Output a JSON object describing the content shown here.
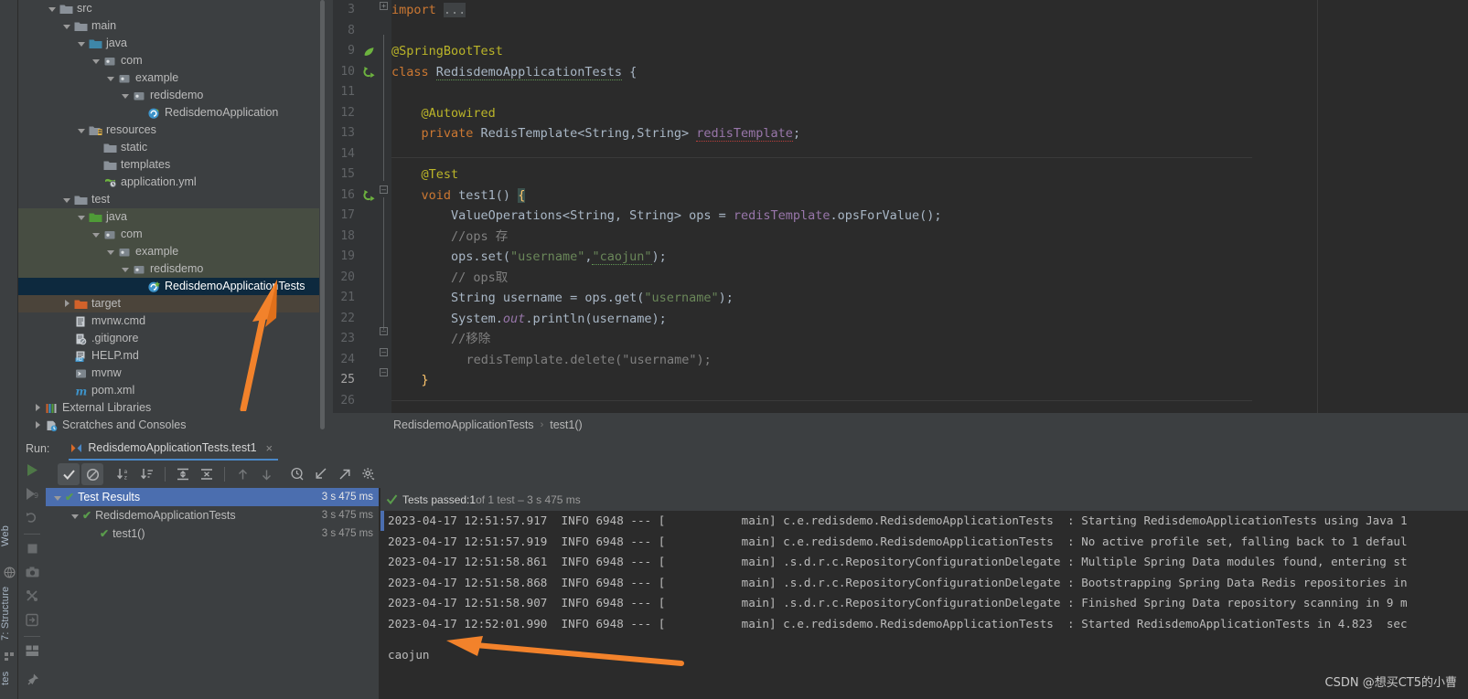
{
  "left_strip": {
    "labels": [
      {
        "name": "web",
        "text": "Web"
      },
      {
        "name": "structure",
        "text": "7: Structure"
      },
      {
        "name": "tes",
        "text": "tes"
      }
    ]
  },
  "project_tree": {
    "items": [
      {
        "label": "src",
        "indent": 2,
        "arrow": "down",
        "icon": "folder-src",
        "state": "normal"
      },
      {
        "label": "main",
        "indent": 3,
        "arrow": "down",
        "icon": "folder-grey",
        "state": "normal"
      },
      {
        "label": "java",
        "indent": 4,
        "arrow": "down",
        "icon": "folder-blue",
        "state": "normal"
      },
      {
        "label": "com",
        "indent": 5,
        "arrow": "down",
        "icon": "package",
        "state": "normal"
      },
      {
        "label": "example",
        "indent": 6,
        "arrow": "down",
        "icon": "package",
        "state": "normal"
      },
      {
        "label": "redisdemo",
        "indent": 7,
        "arrow": "down",
        "icon": "package",
        "state": "normal"
      },
      {
        "label": "RedisdemoApplication",
        "indent": 8,
        "arrow": "none",
        "icon": "class-spring",
        "state": "normal"
      },
      {
        "label": "resources",
        "indent": 4,
        "arrow": "down",
        "icon": "folder-resource",
        "state": "normal"
      },
      {
        "label": "static",
        "indent": 5,
        "arrow": "none",
        "icon": "folder-grey",
        "state": "normal"
      },
      {
        "label": "templates",
        "indent": 5,
        "arrow": "none",
        "icon": "folder-grey",
        "state": "normal"
      },
      {
        "label": "application.yml",
        "indent": 5,
        "arrow": "none",
        "icon": "yml-file",
        "state": "normal"
      },
      {
        "label": "test",
        "indent": 3,
        "arrow": "down",
        "icon": "folder-grey",
        "state": "normal"
      },
      {
        "label": "java",
        "indent": 4,
        "arrow": "down",
        "icon": "folder-green",
        "state": "tint-green"
      },
      {
        "label": "com",
        "indent": 5,
        "arrow": "down",
        "icon": "package",
        "state": "tint-green"
      },
      {
        "label": "example",
        "indent": 6,
        "arrow": "down",
        "icon": "package",
        "state": "tint-green"
      },
      {
        "label": "redisdemo",
        "indent": 7,
        "arrow": "down",
        "icon": "package",
        "state": "tint-green"
      },
      {
        "label": "RedisdemoApplicationTests",
        "indent": 8,
        "arrow": "none",
        "icon": "class-test",
        "state": "sel-blue"
      },
      {
        "label": "target",
        "indent": 3,
        "arrow": "right",
        "icon": "folder-target",
        "state": "tint-brown"
      },
      {
        "label": "mvnw.cmd",
        "indent": 3,
        "arrow": "none",
        "icon": "file-cmd",
        "state": "normal"
      },
      {
        "label": ".gitignore",
        "indent": 3,
        "arrow": "none",
        "icon": "file-gitignore",
        "state": "normal"
      },
      {
        "label": "HELP.md",
        "indent": 3,
        "arrow": "none",
        "icon": "file-md",
        "state": "normal"
      },
      {
        "label": "mvnw",
        "indent": 3,
        "arrow": "none",
        "icon": "file-script",
        "state": "normal"
      },
      {
        "label": "pom.xml",
        "indent": 3,
        "arrow": "none",
        "icon": "file-maven",
        "state": "normal"
      },
      {
        "label": "External Libraries",
        "indent": 1,
        "arrow": "right",
        "icon": "libraries",
        "state": "normal"
      },
      {
        "label": "Scratches and Consoles",
        "indent": 1,
        "arrow": "right",
        "icon": "scratches",
        "state": "normal"
      }
    ]
  },
  "editor": {
    "gutter_lines": [
      {
        "num": "3",
        "mark": "none"
      },
      {
        "num": "8",
        "mark": "none"
      },
      {
        "num": "9",
        "mark": "spring-leaf"
      },
      {
        "num": "10",
        "mark": "run-test"
      },
      {
        "num": "11",
        "mark": "none"
      },
      {
        "num": "12",
        "mark": "none"
      },
      {
        "num": "13",
        "mark": "none"
      },
      {
        "num": "14",
        "mark": "none"
      },
      {
        "num": "15",
        "mark": "none"
      },
      {
        "num": "16",
        "mark": "run-test"
      },
      {
        "num": "17",
        "mark": "none"
      },
      {
        "num": "18",
        "mark": "none"
      },
      {
        "num": "19",
        "mark": "none"
      },
      {
        "num": "20",
        "mark": "none"
      },
      {
        "num": "21",
        "mark": "none"
      },
      {
        "num": "22",
        "mark": "none"
      },
      {
        "num": "23",
        "mark": "none"
      },
      {
        "num": "24",
        "mark": "none"
      },
      {
        "num": "25",
        "mark": "none"
      },
      {
        "num": "26",
        "mark": "none"
      }
    ],
    "current_line": "25",
    "code_lines": [
      "import ...",
      "",
      "@SpringBootTest",
      "class RedisdemoApplicationTests {",
      "",
      "    @Autowired",
      "    private RedisTemplate<String,String> redisTemplate;",
      "",
      "    @Test",
      "    void test1() {",
      "        ValueOperations<String, String> ops = redisTemplate.opsForValue();",
      "        //ops 存",
      "        ops.set(\"username\",\"caojun\");",
      "        // ops取",
      "        String username = ops.get(\"username\");",
      "        System.out.println(username);",
      "        //移除",
      "          redisTemplate.delete(\"username\");",
      "    }",
      "",
      "}"
    ],
    "breadcrumb": {
      "class": "RedisdemoApplicationTests",
      "separator": "›",
      "method": "test1()"
    }
  },
  "run_panel": {
    "run_label": "Run:",
    "tab_title": "RedisdemoApplicationTests.test1",
    "close_glyph": "×",
    "toolbar": [
      {
        "name": "rerun-button",
        "icon": "play"
      },
      {
        "name": "show-passed-toggle",
        "icon": "check"
      },
      {
        "name": "show-ignored-toggle",
        "icon": "ban"
      },
      {
        "name": "sort-alphabetically",
        "icon": "sort-az"
      },
      {
        "name": "sort-by-duration",
        "icon": "sort-dur"
      },
      {
        "name": "expand-all",
        "icon": "expand"
      },
      {
        "name": "collapse-all",
        "icon": "collapse"
      },
      {
        "name": "previous-failed-test",
        "icon": "arrow-up"
      },
      {
        "name": "next-failed-test",
        "icon": "arrow-down"
      },
      {
        "name": "test-history",
        "icon": "clock"
      },
      {
        "name": "import-tests",
        "icon": "import"
      },
      {
        "name": "export-tests",
        "icon": "export"
      },
      {
        "name": "test-settings",
        "icon": "gear"
      }
    ],
    "side_icons": [
      {
        "name": "run-icon",
        "icon": "play-green"
      },
      {
        "name": "debug-icon",
        "icon": "debug"
      },
      {
        "name": "rerun-icon",
        "icon": "rerun"
      },
      {
        "name": "stop-icon",
        "icon": "stop"
      },
      {
        "name": "camera-icon",
        "icon": "camera"
      },
      {
        "name": "thread-icon",
        "icon": "threads"
      },
      {
        "name": "export-icon",
        "icon": "export-box"
      },
      {
        "name": "layout-icon",
        "icon": "layout"
      },
      {
        "name": "pin-icon",
        "icon": "pin"
      }
    ],
    "test_tree": [
      {
        "label": "Test Results",
        "indent": 0,
        "arrow": "down",
        "time": "3 s 475 ms",
        "selected": true
      },
      {
        "label": "RedisdemoApplicationTests",
        "indent": 1,
        "arrow": "down",
        "time": "3 s 475 ms",
        "selected": false
      },
      {
        "label": "test1()",
        "indent": 2,
        "arrow": "none",
        "time": "3 s 475 ms",
        "selected": false
      }
    ],
    "status": {
      "prefix": "Tests passed: ",
      "count": "1",
      "suffix": " of 1 test – 3 s 475 ms"
    },
    "console_lines": [
      "2023-04-17 12:51:57.917  INFO 6948 --- [           main] c.e.redisdemo.RedisdemoApplicationTests  : Starting RedisdemoApplicationTests using Java 1",
      "2023-04-17 12:51:57.919  INFO 6948 --- [           main] c.e.redisdemo.RedisdemoApplicationTests  : No active profile set, falling back to 1 defaul",
      "2023-04-17 12:51:58.861  INFO 6948 --- [           main] .s.d.r.c.RepositoryConfigurationDelegate : Multiple Spring Data modules found, entering st",
      "2023-04-17 12:51:58.868  INFO 6948 --- [           main] .s.d.r.c.RepositoryConfigurationDelegate : Bootstrapping Spring Data Redis repositories in",
      "2023-04-17 12:51:58.907  INFO 6948 --- [           main] .s.d.r.c.RepositoryConfigurationDelegate : Finished Spring Data repository scanning in 9 m",
      "2023-04-17 12:52:01.990  INFO 6948 --- [           main] c.e.redisdemo.RedisdemoApplicationTests  : Started RedisdemoApplicationTests in 4.823  sec"
    ],
    "program_output": "caojun"
  },
  "watermark": "CSDN @想买CT5的小曹",
  "colors": {
    "accent_blue": "#4b6eaf",
    "selection_blue": "#0d293e",
    "tab_underline": "#4a88c7",
    "pass_green": "#5a9c4c",
    "arrow_orange": "#f2822b",
    "editor_bg": "#2b2b2b",
    "panel_bg": "#3c3f41"
  }
}
